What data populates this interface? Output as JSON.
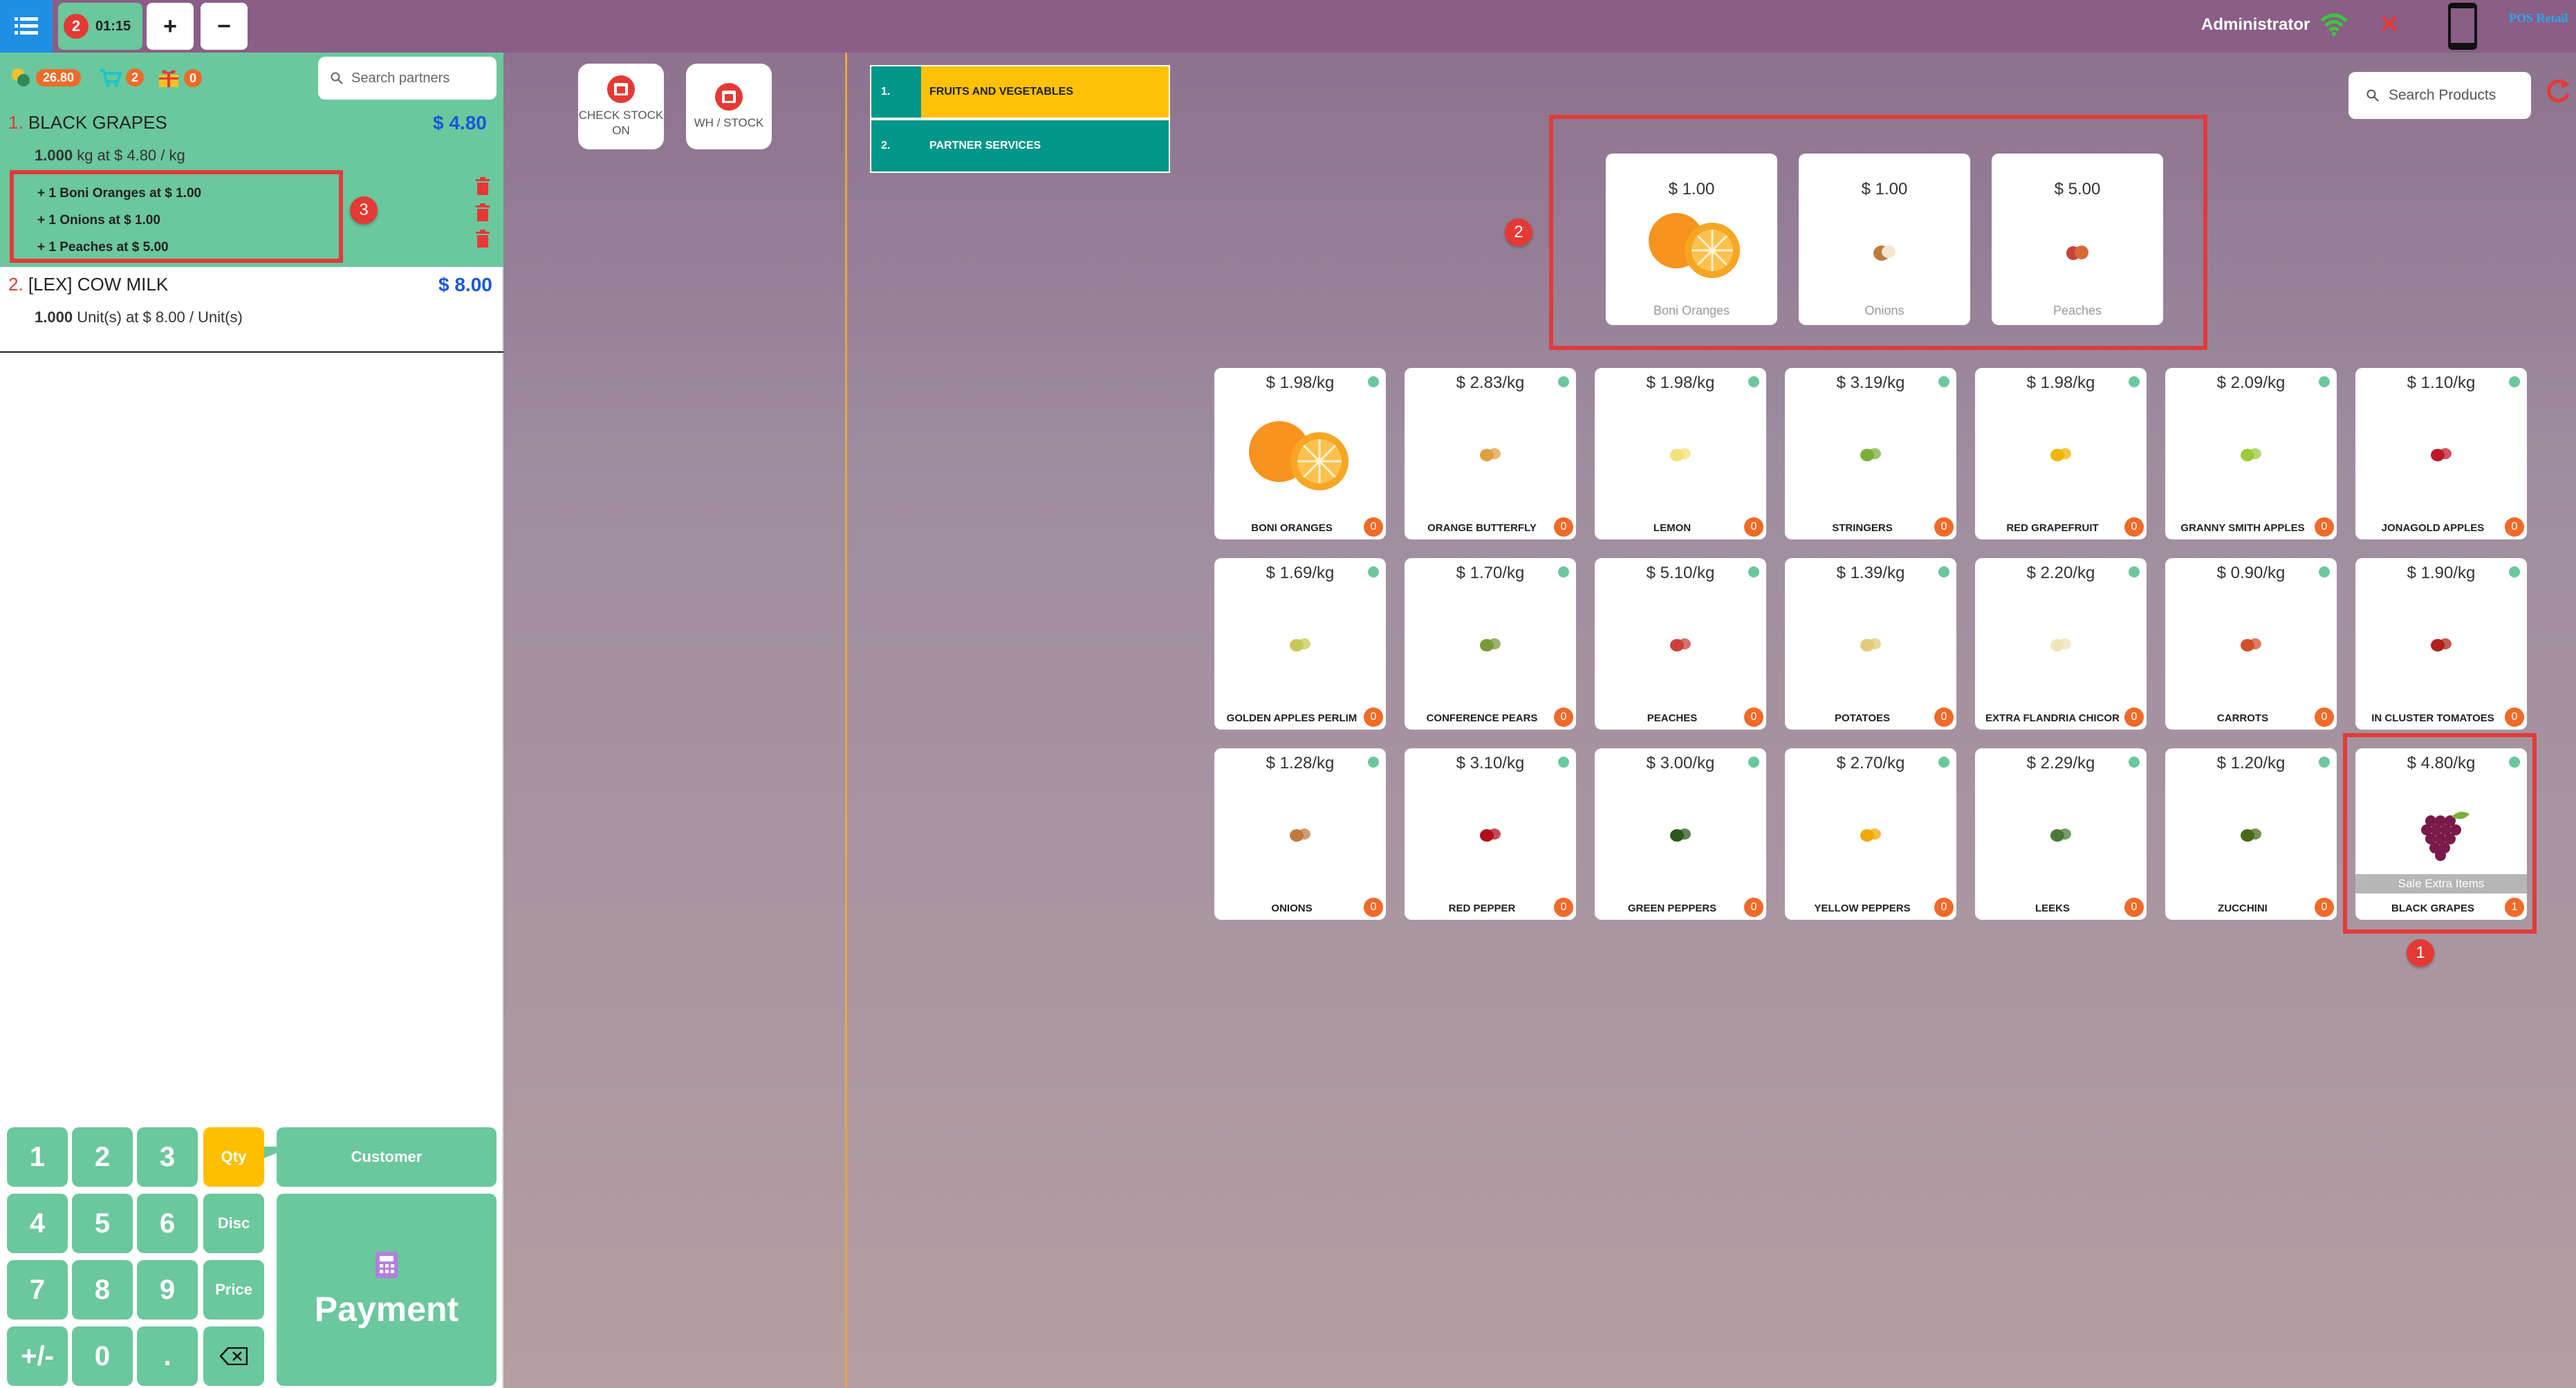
{
  "topbar": {
    "order_count": "2",
    "order_time": "01:15",
    "add_label": "+",
    "remove_label": "−",
    "user": "Administrator",
    "brand": "POS Retail"
  },
  "loyalty": {
    "points": "26.80",
    "cart_count": "2",
    "gift_count": "0"
  },
  "search": {
    "partners_placeholder": "Search partners",
    "products_placeholder": "Search Products"
  },
  "order": {
    "lines": [
      {
        "num": "1.",
        "name": "BLACK GRAPES",
        "price": "$ 4.80",
        "qty": "1.000",
        "detail": "kg at $ 4.80 / kg"
      },
      {
        "num": "2.",
        "name": "[LEX] COW MILK",
        "price": "$ 8.00",
        "qty": "1.000",
        "detail": "Unit(s) at $ 8.00 / Unit(s)"
      }
    ],
    "extras": [
      "+ 1 Boni Oranges at $ 1.00",
      "+ 1 Onions at $ 1.00",
      "+ 1 Peaches at $ 5.00"
    ]
  },
  "markers": {
    "m1": "1",
    "m2": "2",
    "m3": "3"
  },
  "numpad": {
    "keys": [
      "1",
      "2",
      "3",
      "4",
      "5",
      "6",
      "7",
      "8",
      "9",
      "+/-",
      "0",
      "."
    ],
    "qty": "Qty",
    "disc": "Disc",
    "price": "Price",
    "customer": "Customer",
    "payment": "Payment"
  },
  "controls": {
    "check_stock": "CHECK STOCK ON",
    "wh_stock": "WH / STOCK"
  },
  "categories": [
    {
      "num": "1.",
      "name": "FRUITS AND VEGETABLES"
    },
    {
      "num": "2.",
      "name": "PARTNER SERVICES"
    }
  ],
  "extra_items": [
    {
      "price": "$ 1.00",
      "name": "Boni Oranges"
    },
    {
      "price": "$ 1.00",
      "name": "Onions"
    },
    {
      "price": "$ 5.00",
      "name": "Peaches"
    }
  ],
  "products": [
    {
      "price": "$ 1.98/kg",
      "name": "BONI ORANGES",
      "qty": "0",
      "icon": "orange-icon",
      "color": "#f7931e"
    },
    {
      "price": "$ 2.83/kg",
      "name": "ORANGE BUTTERFLY",
      "qty": "0",
      "icon": "orange-butterfly-icon",
      "color": "#e0a040"
    },
    {
      "price": "$ 1.98/kg",
      "name": "LEMON",
      "qty": "0",
      "icon": "lemon-icon",
      "color": "#f5e07a"
    },
    {
      "price": "$ 3.19/kg",
      "name": "STRINGERS",
      "qty": "0",
      "icon": "stringers-icon",
      "color": "#7cae3a"
    },
    {
      "price": "$ 1.98/kg",
      "name": "RED GRAPEFRUIT",
      "qty": "0",
      "icon": "grapefruit-icon",
      "color": "#f2b600"
    },
    {
      "price": "$ 2.09/kg",
      "name": "GRANNY SMITH APPLES",
      "qty": "0",
      "icon": "green-apple-icon",
      "color": "#9ccc3c"
    },
    {
      "price": "$ 1.10/kg",
      "name": "JONAGOLD APPLES",
      "qty": "0",
      "icon": "red-apple-icon",
      "color": "#c0182a"
    },
    {
      "price": "$ 1.69/kg",
      "name": "GOLDEN APPLES PERLIM",
      "qty": "0",
      "icon": "golden-apple-icon",
      "color": "#c8c85a"
    },
    {
      "price": "$ 1.70/kg",
      "name": "CONFERENCE PEARS",
      "qty": "0",
      "icon": "pear-icon",
      "color": "#7a9a3a"
    },
    {
      "price": "$ 5.10/kg",
      "name": "PEACHES",
      "qty": "0",
      "icon": "peach-icon",
      "color": "#c8423a"
    },
    {
      "price": "$ 1.39/kg",
      "name": "POTATOES",
      "qty": "0",
      "icon": "potato-icon",
      "color": "#e2c87a"
    },
    {
      "price": "$ 2.20/kg",
      "name": "EXTRA FLANDRIA CHICOR",
      "qty": "0",
      "icon": "chicory-icon",
      "color": "#efe6b8"
    },
    {
      "price": "$ 0.90/kg",
      "name": "CARROTS",
      "qty": "0",
      "icon": "carrot-icon",
      "color": "#d2502a"
    },
    {
      "price": "$ 1.90/kg",
      "name": "IN CLUSTER TOMATOES",
      "qty": "0",
      "icon": "tomato-icon",
      "color": "#b0201a"
    },
    {
      "price": "$ 1.28/kg",
      "name": "ONIONS",
      "qty": "0",
      "icon": "onion-icon",
      "color": "#c07a40"
    },
    {
      "price": "$ 3.10/kg",
      "name": "RED PEPPER",
      "qty": "0",
      "icon": "red-pepper-icon",
      "color": "#b0101e"
    },
    {
      "price": "$ 3.00/kg",
      "name": "GREEN PEPPERS",
      "qty": "0",
      "icon": "green-pepper-icon",
      "color": "#2a5a1a"
    },
    {
      "price": "$ 2.70/kg",
      "name": "YELLOW PEPPERS",
      "qty": "0",
      "icon": "yellow-pepper-icon",
      "color": "#f0a800"
    },
    {
      "price": "$ 2.29/kg",
      "name": "LEEKS",
      "qty": "0",
      "icon": "leek-icon",
      "color": "#4a7a3a"
    },
    {
      "price": "$ 1.20/kg",
      "name": "ZUCCHINI",
      "qty": "0",
      "icon": "zucchini-icon",
      "color": "#4a6a1a"
    },
    {
      "price": "$ 4.80/kg",
      "name": "BLACK GRAPES",
      "qty": "1",
      "icon": "grapes-icon",
      "color": "#7a1a4a",
      "sale": "Sale Extra Items"
    }
  ],
  "colors": {
    "accent_green": "#6bc79c",
    "highlight_red": "#e03b3b",
    "price_blue": "#1a56db",
    "category_yellow": "#ffc107",
    "category_teal": "#009688"
  }
}
